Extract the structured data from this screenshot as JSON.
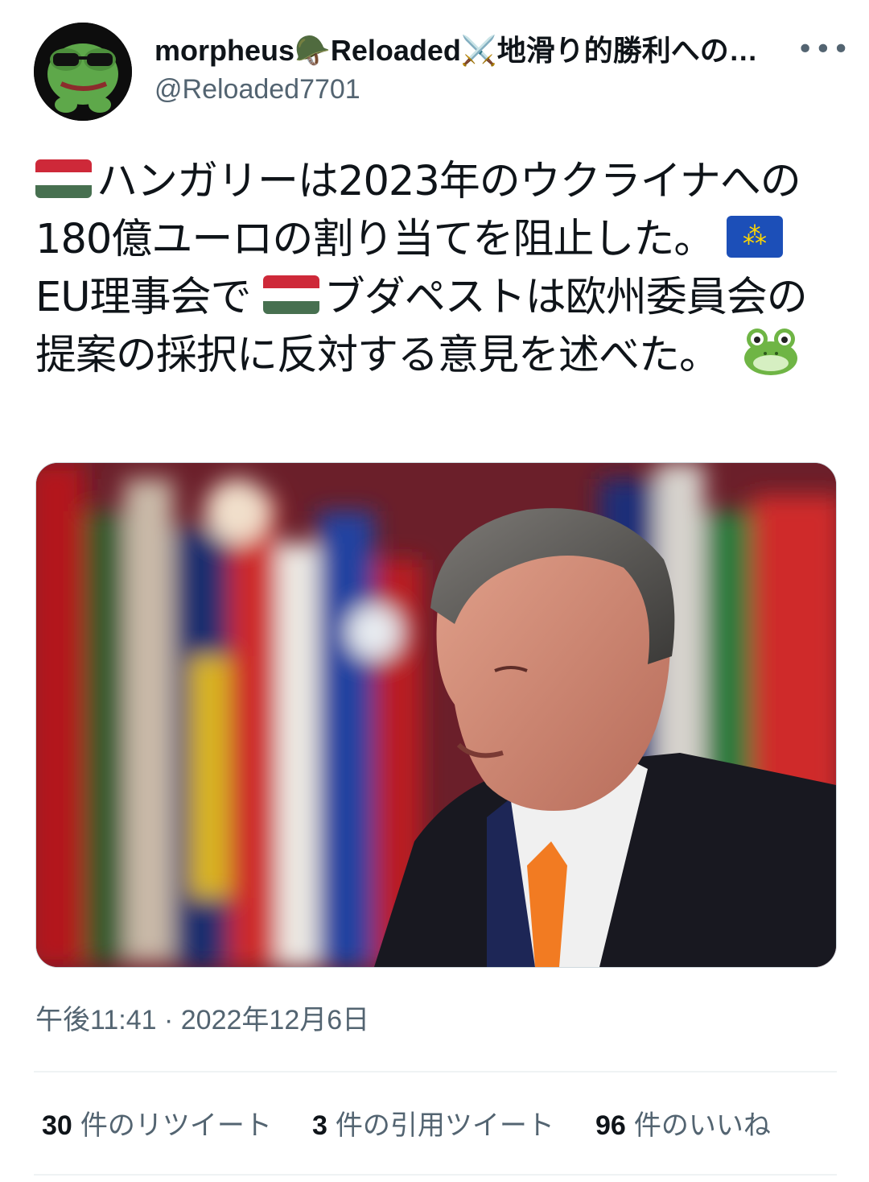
{
  "tweet": {
    "display_name": "morpheus🪖Reloaded⚔️地滑り的勝利への…",
    "handle": "@Reloaded7701",
    "more_icon": "more-horizontal-icon",
    "text_parts": [
      "ハンガリーは2023年のウクライナへの180億ユーロの割り当てを阻止した。",
      "EU理事会で",
      "ブダペストは欧州委員会の提案の採択に反対する意見を述べた。"
    ],
    "timestamp": "午後11:41 · 2022年12月6日"
  },
  "stats": {
    "retweets_count": "30",
    "retweets_label": "件のリツイート",
    "quotes_count": "3",
    "quotes_label": "件の引用ツイート",
    "likes_count": "96",
    "likes_label": "件のいいね"
  },
  "colors": {
    "hungary_red": "#ce2939",
    "hungary_white": "#ffffff",
    "hungary_green": "#477050",
    "eu_blue": "#1c4fb8",
    "secondary_text": "#536471"
  }
}
